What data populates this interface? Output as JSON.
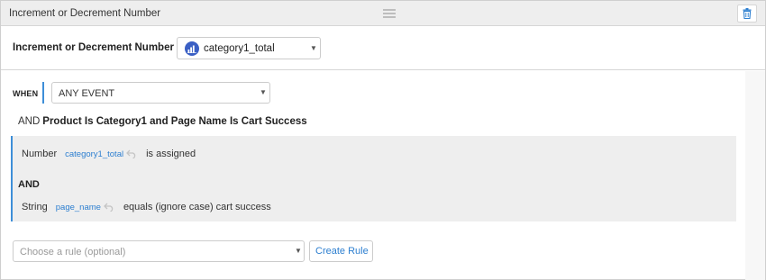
{
  "header": {
    "title": "Increment or Decrement Number"
  },
  "setting": {
    "label": "Increment or Decrement Number by",
    "variable": "category1_total"
  },
  "trigger": {
    "when_label": "WHEN",
    "event": "ANY EVENT"
  },
  "condition": {
    "and_label": "AND",
    "summary": "Product Is Category1 and Page Name Is Cart Success",
    "clauses": [
      {
        "type": "Number",
        "variable": "category1_total",
        "operator": "is assigned"
      },
      {
        "type": "String",
        "variable": "page_name",
        "operator": "equals (ignore case) cart success"
      }
    ],
    "joiner": "AND"
  },
  "rule": {
    "placeholder": "Choose a rule (optional)",
    "create_label": "Create Rule"
  },
  "icons": {
    "delete": "trash-icon",
    "drag": "drag-handle-icon",
    "variable": "bar-chart-icon",
    "undo": "undo-arrow-icon"
  },
  "colors": {
    "accent": "#3d8ed8",
    "link": "#2d7fd0",
    "variable_icon_bg": "#3a5fc4",
    "header_bg": "#eeeeee",
    "condition_bg": "#eeeeee"
  }
}
